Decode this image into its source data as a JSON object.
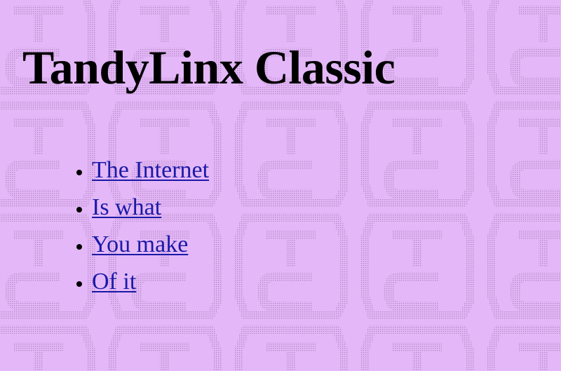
{
  "page": {
    "title": "TandyLinx Classic",
    "background_color": "#e4b8f8",
    "pattern_color": "#b889c9",
    "pattern_letters": [
      "T",
      "C"
    ],
    "link_color": "#1a1aa6"
  },
  "links": [
    {
      "label": "The Internet"
    },
    {
      "label": "Is what"
    },
    {
      "label": "You make"
    },
    {
      "label": "Of it"
    }
  ]
}
